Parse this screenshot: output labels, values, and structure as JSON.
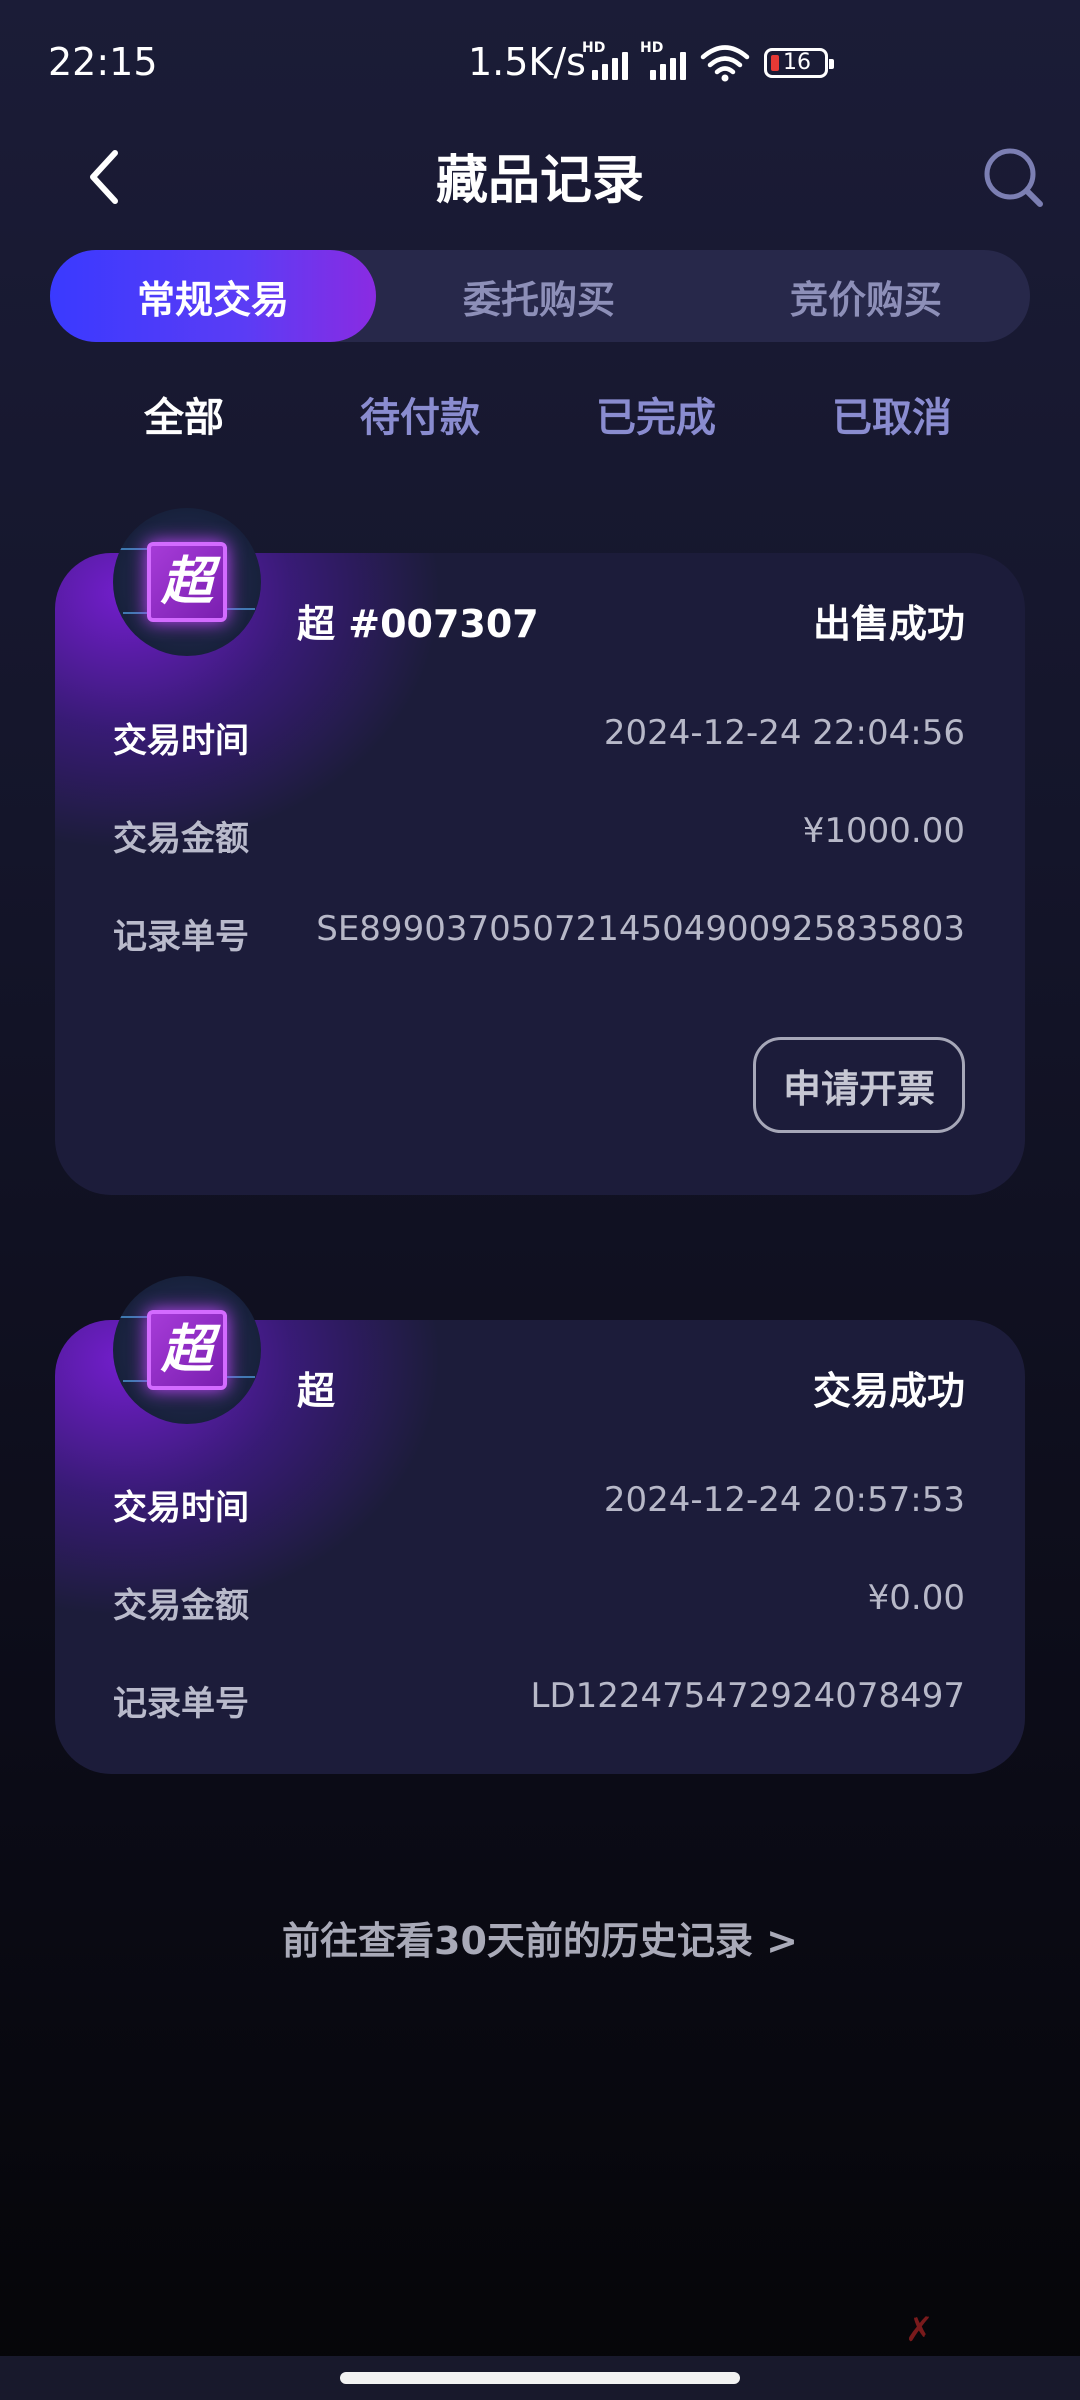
{
  "status_bar": {
    "time": "22:15",
    "net_speed": "1.5K/s",
    "signal_label": "HD",
    "battery": "16"
  },
  "header": {
    "title": "藏品记录",
    "back_icon": "chevron-left-icon",
    "search_icon": "search-icon"
  },
  "segment_tabs": [
    {
      "label": "常规交易",
      "active": true
    },
    {
      "label": "委托购买",
      "active": false
    },
    {
      "label": "竞价购买",
      "active": false
    }
  ],
  "filter_tabs": [
    {
      "label": "全部",
      "active": true
    },
    {
      "label": "待付款",
      "active": false
    },
    {
      "label": "已完成",
      "active": false
    },
    {
      "label": "已取消",
      "active": false
    }
  ],
  "records": [
    {
      "thumb_char": "超",
      "name": "超 #007307",
      "status": "出售成功",
      "time_label": "交易时间",
      "time": "2024-12-24 22:04:56",
      "amount_label": "交易金额",
      "amount": "¥1000.00",
      "id_label": "记录单号",
      "record_id": "SE8990370507214504900925835803",
      "action": "申请开票"
    },
    {
      "thumb_char": "超",
      "name": "超",
      "status": "交易成功",
      "time_label": "交易时间",
      "time": "2024-12-24 20:57:53",
      "amount_label": "交易金额",
      "amount": "¥0.00",
      "id_label": "记录单号",
      "record_id": "LD122475472924078497"
    }
  ],
  "history_link": "前往查看30天前的历史记录 >"
}
